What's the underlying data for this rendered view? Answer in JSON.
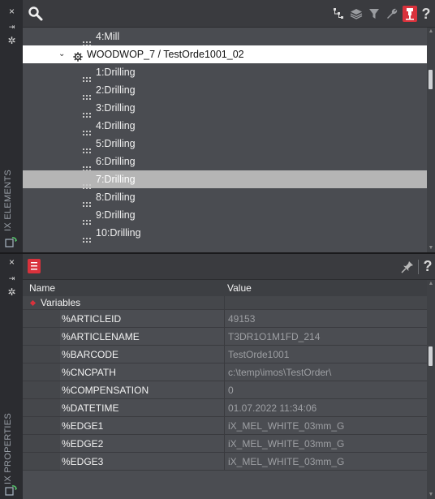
{
  "elements_panel": {
    "side_label": "IX ELEMENTS",
    "tree": [
      {
        "label": "4:Mill",
        "level": 2
      },
      {
        "label": "WOODWOP_7 / TestOrde1001_02",
        "level": 1
      },
      {
        "label": "1:Drilling",
        "level": 2
      },
      {
        "label": "2:Drilling",
        "level": 2
      },
      {
        "label": "3:Drilling",
        "level": 2
      },
      {
        "label": "4:Drilling",
        "level": 2
      },
      {
        "label": "5:Drilling",
        "level": 2
      },
      {
        "label": "6:Drilling",
        "level": 2
      },
      {
        "label": "7:Drilling",
        "level": 2
      },
      {
        "label": "8:Drilling",
        "level": 2
      },
      {
        "label": "9:Drilling",
        "level": 2
      },
      {
        "label": "10:Drilling",
        "level": 2
      }
    ],
    "selected_index": 1,
    "highlight_index": 8,
    "toolbar_icons": [
      "tree-structure-icon",
      "layers-icon",
      "filter-icon",
      "wrench-icon",
      "machine-red-icon",
      "help-icon"
    ],
    "help_label": "?"
  },
  "properties_panel": {
    "side_label": "IX PROPERTIES",
    "help_label": "?",
    "columns": {
      "name": "Name",
      "value": "Value"
    },
    "group_label": "Variables",
    "rows": [
      {
        "name": "%ARTICLEID",
        "value": "49153"
      },
      {
        "name": "%ARTICLENAME",
        "value": "T3DR1O1M1FD_214"
      },
      {
        "name": "%BARCODE",
        "value": "TestOrde1001"
      },
      {
        "name": "%CNCPATH",
        "value": "c:\\temp\\imos\\TestOrder\\"
      },
      {
        "name": "%COMPENSATION",
        "value": "0"
      },
      {
        "name": "%DATETIME",
        "value": "01.07.2022 11:34:06"
      },
      {
        "name": "%EDGE1",
        "value": "iX_MEL_WHITE_03mm_G"
      },
      {
        "name": "%EDGE2",
        "value": "iX_MEL_WHITE_03mm_G"
      },
      {
        "name": "%EDGE3",
        "value": "iX_MEL_WHITE_03mm_G"
      }
    ]
  },
  "side_buttons": {
    "close": "×",
    "pin": "⇥",
    "settings": "✲"
  },
  "colors": {
    "accent": "#d9323c",
    "selection": "#ffffff",
    "highlight": "#b5b5b5"
  }
}
